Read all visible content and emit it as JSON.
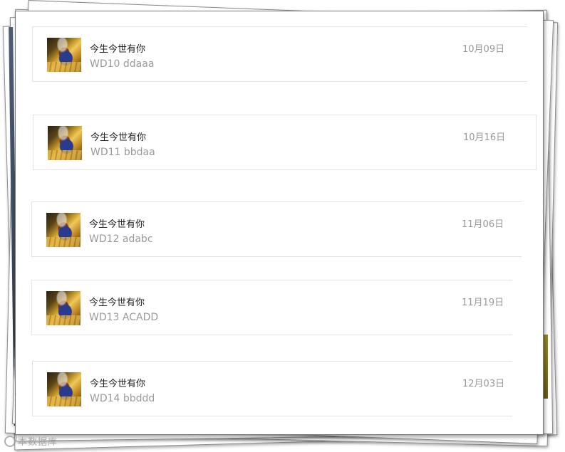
{
  "messages": [
    {
      "name": "今生今世有你",
      "text": "WD10 ddaaa",
      "date": "10月09日"
    },
    {
      "name": "今生今世有你",
      "text": "WD11 bbdaa",
      "date": "10月16日"
    },
    {
      "name": "今生今世有你",
      "text": "WD12 adabc",
      "date": "11月06日"
    },
    {
      "name": "今生今世有你",
      "text": "WD13 ACADD",
      "date": "11月19日"
    },
    {
      "name": "今生今世有你",
      "text": "WD14 bbddd",
      "date": "12月03日"
    }
  ],
  "watermark": "本数据库"
}
